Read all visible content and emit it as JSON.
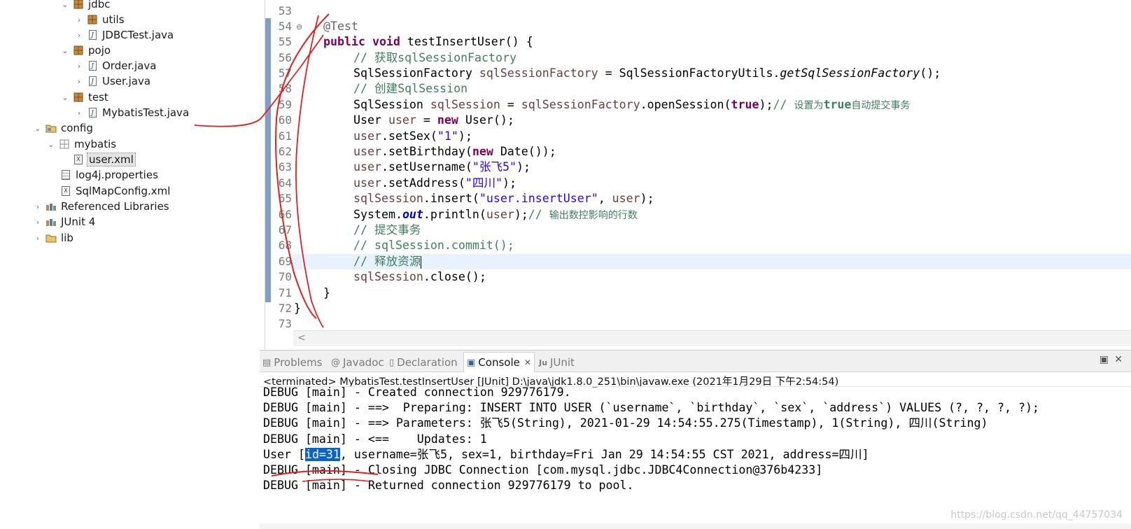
{
  "explorer": {
    "items": [
      {
        "label": "jdbc",
        "kind": "package",
        "expanded": true
      },
      {
        "label": "utils",
        "kind": "package",
        "expanded": false
      },
      {
        "label": "JDBCTest.java",
        "kind": "java",
        "expanded": false
      },
      {
        "label": "pojo",
        "kind": "package",
        "expanded": true
      },
      {
        "label": "Order.java",
        "kind": "java",
        "expanded": false
      },
      {
        "label": "User.java",
        "kind": "java",
        "expanded": false
      },
      {
        "label": "test",
        "kind": "package",
        "expanded": true
      },
      {
        "label": "MybatisTest.java",
        "kind": "java",
        "expanded": false
      },
      {
        "label": "config",
        "kind": "folder",
        "expanded": true
      },
      {
        "label": "mybatis",
        "kind": "package",
        "expanded": true
      },
      {
        "label": "user.xml",
        "kind": "xml",
        "selected": true
      },
      {
        "label": "log4j.properties",
        "kind": "properties"
      },
      {
        "label": "SqlMapConfig.xml",
        "kind": "xml"
      },
      {
        "label": "Referenced Libraries",
        "kind": "library",
        "expanded": false
      },
      {
        "label": "JUnit 4",
        "kind": "library",
        "expanded": false
      },
      {
        "label": "lib",
        "kind": "folder",
        "expanded": false
      }
    ]
  },
  "editor": {
    "line_numbers": [
      "53",
      "54",
      "55",
      "56",
      "57",
      "58",
      "59",
      "60",
      "61",
      "62",
      "63",
      "64",
      "65",
      "66",
      "67",
      "68",
      "69",
      "70",
      "71",
      "72",
      "73"
    ],
    "fold_marker": "⊖",
    "code": {
      "l54_annotation": "@Test",
      "l55_public": "public",
      "l55_void": "void",
      "l55_rest": " testInsertUser() {",
      "l56": "// 获取sqlSessionFactory",
      "l57_type": "SqlSessionFactory ",
      "l57_var": "sqlSessionFactory",
      "l57_mid": " = SqlSessionFactoryUtils.",
      "l57_call": "getSqlSessionFactory",
      "l57_end": "();",
      "l58": "// 创建SqlSession",
      "l59_type": "SqlSession ",
      "l59_var": "sqlSession",
      "l59_eq": " = ",
      "l59_ref": "sqlSessionFactory",
      "l59_call": ".openSession(",
      "l59_true": "true",
      "l59_end": ");",
      "l59_comment_prefix": "// ",
      "l59_comment_a": "设置为",
      "l59_comment_true": "true",
      "l59_comment_b": "自动提交事务",
      "l60_type": "User ",
      "l60_var": "user",
      "l60_eq": " = ",
      "l60_new": "new",
      "l60_end": " User();",
      "l61_var": "user",
      "l61_call": ".setSex(",
      "l61_str": "\"1\"",
      "l61_end": ");",
      "l62_var": "user",
      "l62_call": ".setBirthday(",
      "l62_new": "new",
      "l62_end": " Date());",
      "l63_var": "user",
      "l63_call": ".setUsername(",
      "l63_str": "\"张飞5\"",
      "l63_end": ");",
      "l64_var": "user",
      "l64_call": ".setAddress(",
      "l64_str": "\"四川\"",
      "l64_end": ");",
      "l65_var": "sqlSession",
      "l65_call": ".insert(",
      "l65_str": "\"user.insertUser\"",
      "l65_sep": ", ",
      "l65_arg": "user",
      "l65_end": ");",
      "l66_cls": "System.",
      "l66_out": "out",
      "l66_call": ".println(",
      "l66_arg": "user",
      "l66_end": ");",
      "l66_comment_prefix": "// ",
      "l66_comment": "输出数控影响的行数",
      "l67": "// 提交事务",
      "l68": "// sqlSession.commit();",
      "l69": "// 释放资源",
      "l70_var": "sqlSession",
      "l70_end": ".close();",
      "l71": "}",
      "l72": "}"
    },
    "scroll_left_glyph": "<"
  },
  "console": {
    "tabs": [
      {
        "label": "Problems",
        "icon": "▤"
      },
      {
        "label": "Javadoc",
        "icon": "@"
      },
      {
        "label": "Declaration",
        "icon": "▯"
      },
      {
        "label": "Console",
        "icon": "▣",
        "active": true
      },
      {
        "label": "JUnit",
        "icon": "Ju"
      }
    ],
    "close_glyph": "✕",
    "terminated_line": "<terminated> MybatisTest.testInsertUser [JUnit] D:\\java\\jdk1.8.0_251\\bin\\javaw.exe (2021年1月29日 下午2:54:54)",
    "lines": [
      "DEBUG [main] - Created connection 929776179.",
      "DEBUG [main] - ==>  Preparing: INSERT INTO USER (`username`, `birthday`, `sex`, `address`) VALUES (?, ?, ?, ?);",
      "DEBUG [main] - ==> Parameters: 张飞5(String), 2021-01-29 14:54:55.275(Timestamp), 1(String), 四川(String)",
      "DEBUG [main] - <==    Updates: 1",
      "",
      "DEBUG [main] - Closing JDBC Connection [com.mysql.jdbc.JDBC4Connection@376b4233]",
      "DEBUG [main] - Returned connection 929776179 to pool."
    ],
    "user_line": {
      "prefix": "User [",
      "highlight": "id=31",
      "suffix": ", username=张飞5, sex=1, birthday=Fri Jan 29 14:54:55 CST 2021, address=四川]"
    },
    "watermark": "https://blog.csdn.net/qq_44757034",
    "view_buttons": [
      "▣",
      "✕"
    ]
  },
  "colors": {
    "keyword": "#7f0055",
    "comment": "#3f7f5f",
    "string": "#2a00ff",
    "field": "#0000c0",
    "selection": "#0a64c8",
    "annotation_stroke": "#e02020",
    "gutter": "#7f9fc6"
  }
}
